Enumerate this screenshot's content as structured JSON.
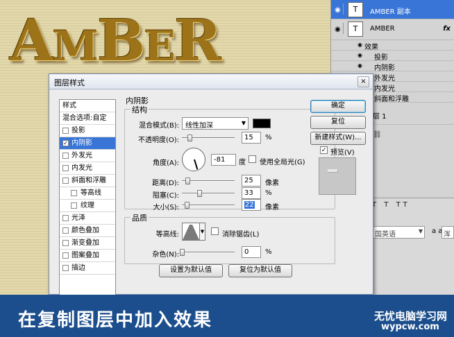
{
  "canvas": {
    "title_big": "A",
    "title_small_1": "M",
    "title_big_2": "B",
    "title_small_2": "E",
    "title_big_3": "R"
  },
  "layers": {
    "selected_layer": "AMBER 副本",
    "layer_amber": "AMBER",
    "fx_label": "fx",
    "effects_header": "效果",
    "effects": [
      "投影",
      "内阴影",
      "外发光",
      "内发光",
      "斜面和浮雕"
    ],
    "bottom_layer": "层 1",
    "thumb_glyph": "T"
  },
  "char_panel": {
    "language": "国英语",
    "aa_icon": "a a",
    "aa_value": "浑厚"
  },
  "dialog": {
    "title": "图层样式",
    "close": "×",
    "style_list": {
      "header": "样式",
      "blend_options": "混合选项:自定",
      "items": [
        {
          "label": "投影",
          "checked": false,
          "sub": false
        },
        {
          "label": "内阴影",
          "checked": true,
          "sub": false,
          "selected": true
        },
        {
          "label": "外发光",
          "checked": false,
          "sub": false
        },
        {
          "label": "内发光",
          "checked": false,
          "sub": false
        },
        {
          "label": "斜面和浮雕",
          "checked": false,
          "sub": false
        },
        {
          "label": "等高线",
          "checked": false,
          "sub": true
        },
        {
          "label": "纹理",
          "checked": false,
          "sub": true
        },
        {
          "label": "光泽",
          "checked": false,
          "sub": false
        },
        {
          "label": "颜色叠加",
          "checked": false,
          "sub": false
        },
        {
          "label": "渐变叠加",
          "checked": false,
          "sub": false
        },
        {
          "label": "图案叠加",
          "checked": false,
          "sub": false
        },
        {
          "label": "描边",
          "checked": false,
          "sub": false
        }
      ]
    },
    "section_title": "内阴影",
    "structure": {
      "label": "结构",
      "blend_mode_label": "混合模式(B):",
      "blend_mode_value": "线性加深",
      "opacity_label": "不透明度(O):",
      "opacity_value": "15",
      "opacity_unit": "%",
      "opacity_fraction": 0.15,
      "angle_label": "角度(A):",
      "angle_value": "-81",
      "angle_unit": "度",
      "global_light_label": "使用全局光(G)",
      "global_light_checked": false,
      "distance_label": "距离(D):",
      "distance_value": "25",
      "distance_unit": "像素",
      "distance_fraction": 0.1,
      "choke_label": "阻塞(C):",
      "choke_value": "33",
      "choke_unit": "%",
      "choke_fraction": 0.33,
      "size_label": "大小(S):",
      "size_value": "22",
      "size_unit": "像素",
      "size_fraction": 0.09
    },
    "quality": {
      "label": "品质",
      "contour_label": "等高线:",
      "anti_alias_label": "消除锯齿(L)",
      "anti_alias_checked": false,
      "noise_label": "杂色(N):",
      "noise_value": "0",
      "noise_unit": "%",
      "noise_fraction": 0.0
    },
    "buttons": {
      "set_default": "设置为默认值",
      "reset_default": "复位为默认值",
      "ok": "确定",
      "reset": "复位",
      "new_style": "新建样式(W)...",
      "preview_label": "预览(V)",
      "preview_checked": true
    }
  },
  "banner": {
    "text": "在复制图层中加入效果",
    "watermark_cn": "无忧电脑学习网",
    "watermark_en": "wypcw.com"
  },
  "colors": {
    "selection": "#3875d7",
    "banner": "#1c4e8d",
    "gold": "#9c7318",
    "shadow_color": "#000000"
  }
}
